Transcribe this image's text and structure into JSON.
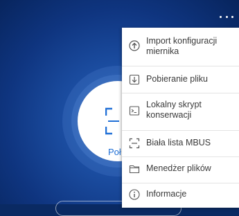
{
  "menu": {
    "items": [
      {
        "label": "Import konfiguracji miernika",
        "icon": "upload-circle-icon"
      },
      {
        "label": "Pobieranie pliku",
        "icon": "download-file-icon"
      },
      {
        "label": "Lokalny skrypt konserwacji",
        "icon": "terminal-icon"
      },
      {
        "label": "Biała lista MBUS",
        "icon": "scan-frame-icon"
      },
      {
        "label": "Menedżer plików",
        "icon": "folder-icon"
      },
      {
        "label": "Informacje",
        "icon": "info-icon"
      }
    ]
  },
  "main": {
    "circle_label": "Poł"
  },
  "colors": {
    "accent": "#1f6fd6",
    "background_dark": "#07245c",
    "menu_bg": "#ffffff",
    "menu_text": "#3a3a3a"
  }
}
